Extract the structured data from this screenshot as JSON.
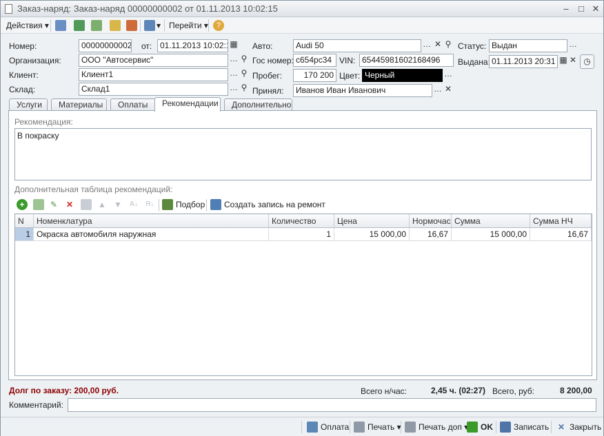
{
  "window": {
    "title": "Заказ-наряд: Заказ-наряд 00000000002 от 01.11.2013 10:02:15"
  },
  "toolbar": {
    "actions": "Действия",
    "goto": "Перейти"
  },
  "form": {
    "number_label": "Номер:",
    "number": "00000000002",
    "date_label": "от:",
    "date": "01.11.2013 10:02:15",
    "auto_label": "Авто:",
    "auto": "Audi 50",
    "status_label": "Статус:",
    "status": "Выдан",
    "org_label": "Организация:",
    "org": "ООО \"Автосервис\"",
    "plate_label": "Гос номер:",
    "plate": "с654рс34",
    "vin_label": "VIN:",
    "vin": "65445981602168496",
    "issued_label": "Выдана:",
    "issued": "01.11.2013 20:31",
    "client_label": "Клиент:",
    "client": "Клиент1",
    "mileage_label": "Пробег:",
    "mileage": "170 200",
    "color_label": "Цвет:",
    "color": "Черный",
    "warehouse_label": "Склад:",
    "warehouse": "Склад1",
    "accepted_label": "Принял:",
    "accepted": "Иванов Иван Иванович"
  },
  "tabs": [
    "Услуги",
    "Материалы",
    "Оплаты",
    "Рекомендации",
    "Дополнительно"
  ],
  "recommendations": {
    "title": "Рекомендация:",
    "text": "В покраску",
    "table_title": "Дополнительная таблица рекомендаций:",
    "pick_label": "Подбор",
    "create_label": "Создать запись на ремонт",
    "columns": [
      "N",
      "Номенклатура",
      "Количество",
      "Цена",
      "Нормочас",
      "Сумма",
      "Сумма НЧ"
    ],
    "rows": [
      {
        "n": "1",
        "name": "Окраска автомобиля наружная",
        "qty": "1",
        "price": "15 000,00",
        "hours": "16,67",
        "sum": "15 000,00",
        "sum_nh": "16,67"
      }
    ]
  },
  "footer": {
    "debt": "Долг по заказу: 200,00 руб.",
    "total_hours_label": "Всего н/час:",
    "total_hours": "2,45 ч. (02:27)",
    "total_rub_label": "Всего, руб:",
    "total_rub": "8 200,00",
    "comment_label": "Комментарий:",
    "comment": ""
  },
  "buttons": {
    "pay": "Оплата",
    "print": "Печать",
    "print_extra": "Печать доп",
    "ok": "OK",
    "save": "Записать",
    "close": "Закрыть"
  },
  "colors": {
    "debt": "#8b0000",
    "accent_green": "#3a9a2a",
    "accent_red": "#d22222"
  }
}
